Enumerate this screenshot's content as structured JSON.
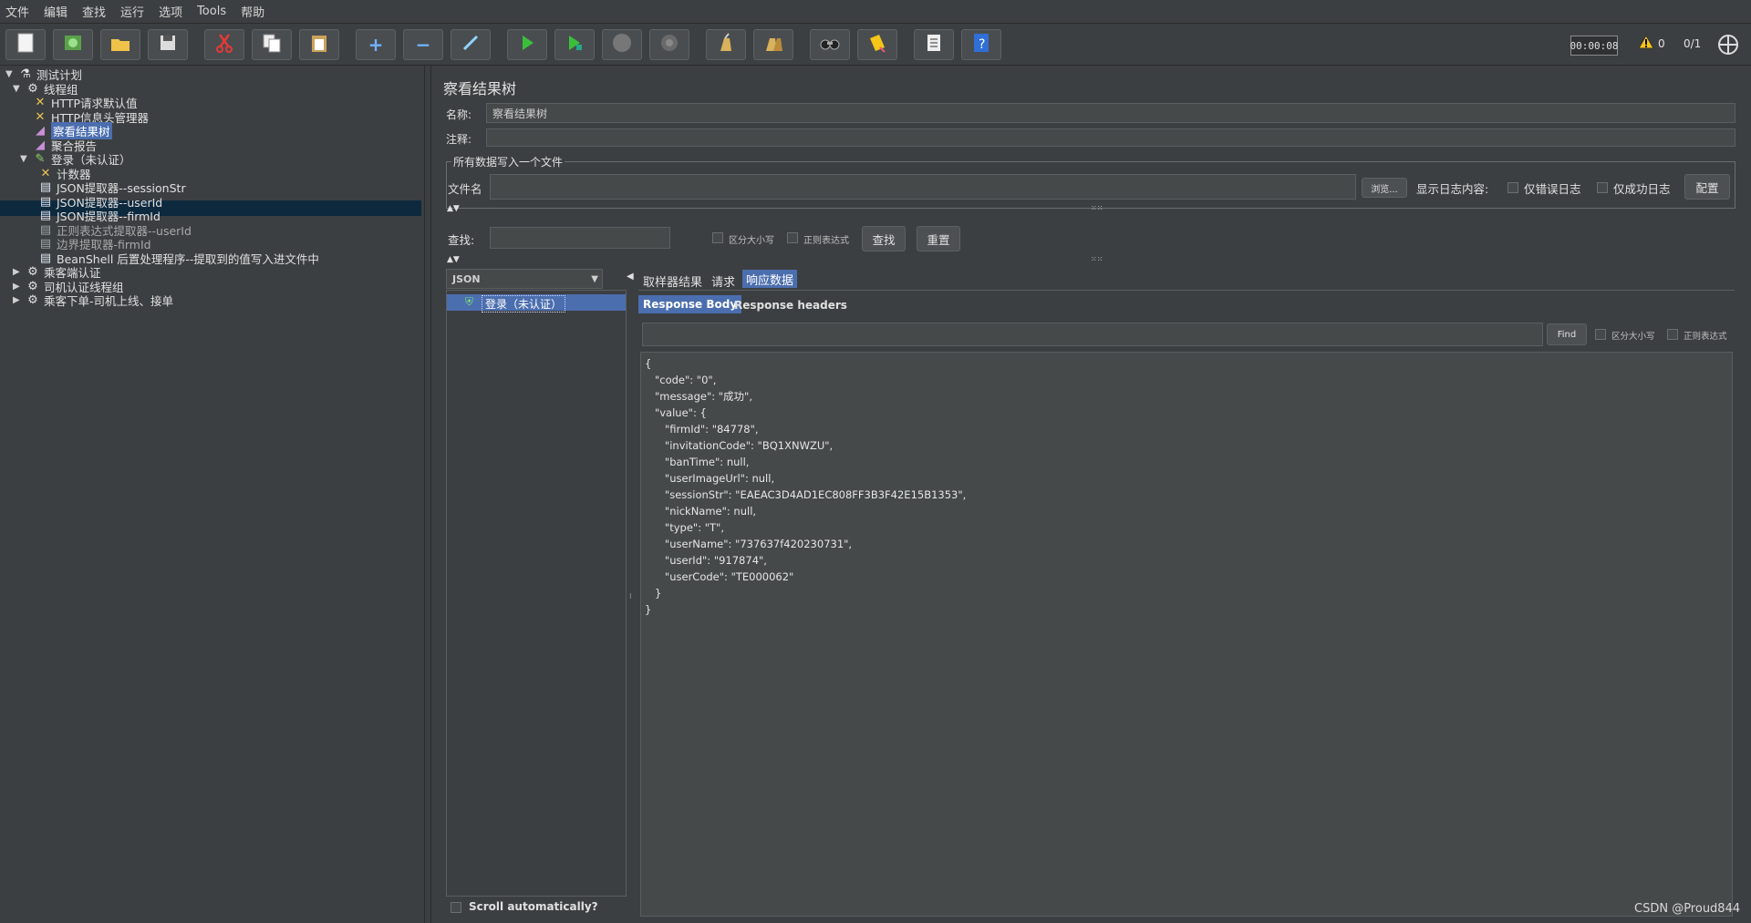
{
  "menu": [
    "文件",
    "编辑",
    "查找",
    "运行",
    "选项",
    "Tools",
    "帮助"
  ],
  "toolbar": {
    "timer": "00:00:08",
    "warnings": "0",
    "threads": "0/1",
    "buttons": [
      "new-icon",
      "template-icon",
      "open-icon",
      "save-icon",
      "cut-icon",
      "copy-icon",
      "paste-icon",
      "expand-icon",
      "collapse-icon",
      "toggle-icon",
      "start-icon",
      "start-no-pause-icon",
      "stop-icon",
      "shutdown-icon",
      "clear-icon",
      "clear-all-icon",
      "search-icon",
      "reset-search-icon",
      "function-helper-icon",
      "help-icon"
    ]
  },
  "tree": {
    "items": [
      {
        "label": "测试计划"
      },
      {
        "label": "线程组"
      },
      {
        "label": "HTTP请求默认值"
      },
      {
        "label": "HTTP信息头管理器"
      },
      {
        "label": "察看结果树"
      },
      {
        "label": "聚合报告"
      },
      {
        "label": "登录（未认证）"
      },
      {
        "label": "计数器"
      },
      {
        "label": "JSON提取器--sessionStr"
      },
      {
        "label": "JSON提取器--userId"
      },
      {
        "label": "JSON提取器--firmId"
      },
      {
        "label": "正则表达式提取器--userId"
      },
      {
        "label": "边界提取器-firmId"
      },
      {
        "label": "BeanShell 后置处理程序--提取到的值写入进文件中"
      },
      {
        "label": "乘客端认证"
      },
      {
        "label": "司机认证线程组"
      },
      {
        "label": "乘客下单-司机上线、接单"
      }
    ]
  },
  "panel": {
    "title": "察看结果树",
    "name_label": "名称:",
    "name_value": "察看结果树",
    "comment_label": "注释:",
    "comment_value": "",
    "file_group_title": "所有数据写入一个文件",
    "file_label": "文件名",
    "browse_label": "浏览...",
    "log_label": "显示日志内容:",
    "errors_only": "仅错误日志",
    "success_only": "仅成功日志",
    "configure": "配置",
    "search_label": "查找:",
    "case_sensitive": "区分大小写",
    "regex": "正则表达式",
    "find_button": "查找",
    "reset_button": "重置",
    "renderer": "JSON",
    "result_item": "登录（未认证）",
    "scroll_auto": "Scroll automatically?",
    "tabs": [
      "取样器结果",
      "请求",
      "响应数据"
    ],
    "subtabs": [
      "Response Body",
      "Response headers"
    ],
    "find_small": "Find",
    "case_small": "区分大小写",
    "regex_small": "正则表达式",
    "response_body": "{\n   \"code\": \"0\",\n   \"message\": \"成功\",\n   \"value\": {\n      \"firmId\": \"84778\",\n      \"invitationCode\": \"BQ1XNWZU\",\n      \"banTime\": null,\n      \"userImageUrl\": null,\n      \"sessionStr\": \"EAEAC3D4AD1EC808FF3B3F42E15B1353\",\n      \"nickName\": null,\n      \"type\": \"T\",\n      \"userName\": \"737637f420230731\",\n      \"userId\": \"917874\",\n      \"userCode\": \"TE000062\"\n   }\n}"
  },
  "watermark": "CSDN @Proud844"
}
